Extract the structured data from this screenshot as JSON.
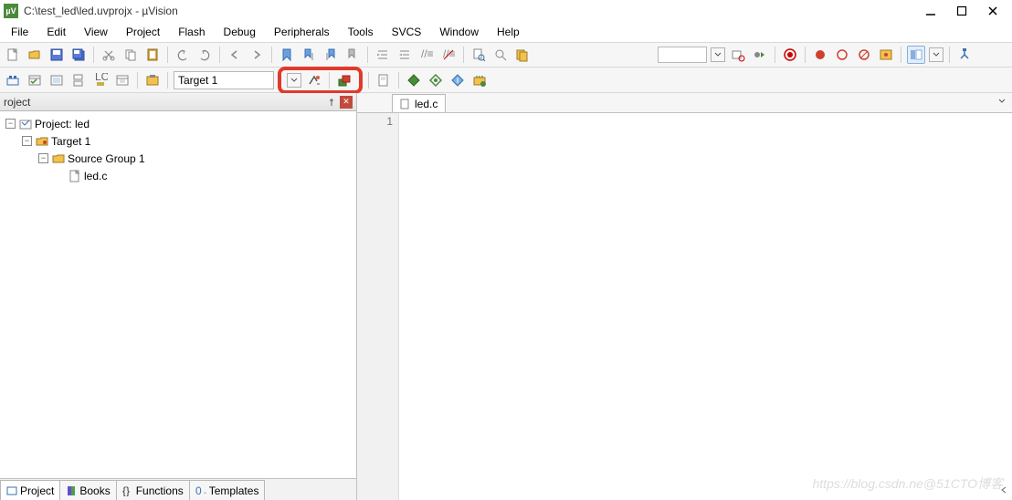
{
  "window": {
    "title": "C:\\test_led\\led.uvprojx - µVision"
  },
  "menu": [
    "File",
    "Edit",
    "View",
    "Project",
    "Flash",
    "Debug",
    "Peripherals",
    "Tools",
    "SVCS",
    "Window",
    "Help"
  ],
  "target": {
    "selected": "Target 1"
  },
  "project_panel": {
    "title": "roject",
    "tree": {
      "root": "Project: led",
      "target": "Target 1",
      "group": "Source Group 1",
      "file": "led.c"
    },
    "tabs": [
      {
        "label": "Project",
        "icon": "project-icon"
      },
      {
        "label": "Books",
        "icon": "books-icon"
      },
      {
        "label": "Functions",
        "icon": "functions-icon"
      },
      {
        "label": "Templates",
        "icon": "templates-icon"
      }
    ]
  },
  "editor": {
    "tab": {
      "label": "led.c"
    },
    "line_number": "1"
  },
  "watermark": "https://blog.csdn.ne@51CTO博客"
}
